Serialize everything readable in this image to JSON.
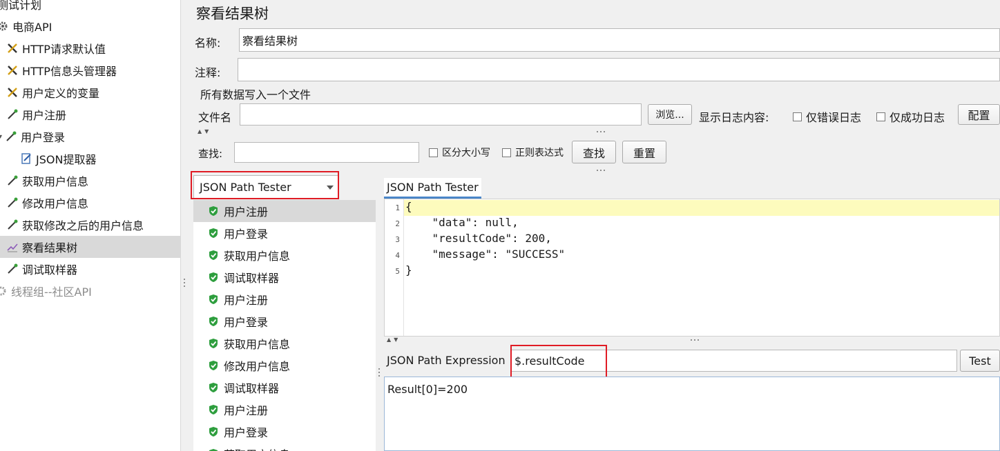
{
  "tree": {
    "items": [
      {
        "label": "测试计划",
        "icon": "test-plan-icon"
      },
      {
        "label": "电商API",
        "icon": "thread-group-gear-icon"
      },
      {
        "label": "HTTP请求默认值",
        "icon": "config-wrench-icon"
      },
      {
        "label": "HTTP信息头管理器",
        "icon": "config-wrench-icon"
      },
      {
        "label": "用户定义的变量",
        "icon": "config-wrench-icon"
      },
      {
        "label": "用户注册",
        "icon": "sampler-pipette-icon"
      },
      {
        "label": "用户登录",
        "icon": "sampler-pipette-icon"
      },
      {
        "label": "JSON提取器",
        "icon": "extractor-icon"
      },
      {
        "label": "获取用户信息",
        "icon": "sampler-pipette-icon"
      },
      {
        "label": "修改用户信息",
        "icon": "sampler-pipette-icon"
      },
      {
        "label": "获取修改之后的用户信息",
        "icon": "sampler-pipette-icon"
      },
      {
        "label": "察看结果树",
        "icon": "listener-chart-icon"
      },
      {
        "label": "调试取样器",
        "icon": "sampler-pipette-icon"
      },
      {
        "label": "线程组--社区API",
        "icon": "disabled-gear-icon"
      }
    ]
  },
  "panel": {
    "title": "察看结果树",
    "name_label": "名称:",
    "name_value": "察看结果树",
    "comment_label": "注释:",
    "comment_value": "",
    "file_group_label": "所有数据写入一个文件",
    "filename_label": "文件名",
    "filename_value": "",
    "browse_button": "浏览...",
    "log_label": "显示日志内容:",
    "errors_only": "仅错误日志",
    "success_only": "仅成功日志",
    "configure_button": "配置"
  },
  "search": {
    "label": "查找:",
    "value": "",
    "case_sensitive": "区分大小写",
    "regex": "正则表达式",
    "find_button": "查找",
    "reset_button": "重置"
  },
  "renderer": {
    "selected": "JSON Path Tester"
  },
  "samples": [
    "用户注册",
    "用户登录",
    "获取用户信息",
    "调试取样器",
    "用户注册",
    "用户登录",
    "获取用户信息",
    "修改用户信息",
    "调试取样器",
    "用户注册",
    "用户登录",
    "获取用户信息"
  ],
  "json_tester": {
    "tab_label": "JSON Path Tester",
    "lines": [
      "{",
      "    \"data\": null,",
      "    \"resultCode\": 200,",
      "    \"message\": \"SUCCESS\"",
      "}"
    ],
    "line_numbers": [
      "1",
      "2",
      "3",
      "4",
      "5"
    ],
    "expression_label": "JSON Path Expression",
    "expression_value": "$.resultCode",
    "test_button": "Test",
    "result": "Result[0]=200"
  },
  "colors": {
    "selection": "#d9d9d9",
    "highlight_line": "#fdfbbd",
    "success_shield": "#2e9e3e",
    "annotation_red": "#e01b24"
  }
}
